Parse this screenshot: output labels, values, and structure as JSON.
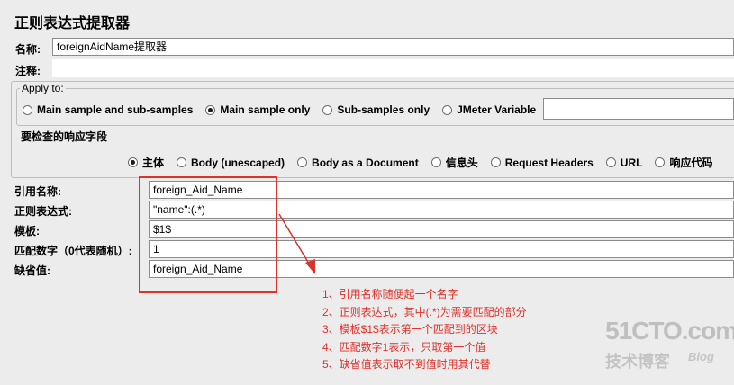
{
  "title": "正则表达式提取器",
  "name_label": "名称:",
  "name_value": "foreignAidName提取器",
  "comment_label": "注释:",
  "comment_value": "",
  "apply_to": {
    "legend": "Apply to:",
    "options": [
      {
        "label": "Main sample and sub-samples",
        "selected": false
      },
      {
        "label": "Main sample only",
        "selected": true
      },
      {
        "label": "Sub-samples only",
        "selected": false
      },
      {
        "label": "JMeter Variable",
        "selected": false
      }
    ],
    "variable_value": ""
  },
  "response_field": {
    "legend": "要检查的响应字段",
    "options": [
      {
        "label": "主体",
        "selected": true
      },
      {
        "label": "Body (unescaped)",
        "selected": false
      },
      {
        "label": "Body as a Document",
        "selected": false
      },
      {
        "label": "信息头",
        "selected": false
      },
      {
        "label": "Request Headers",
        "selected": false
      },
      {
        "label": "URL",
        "selected": false
      },
      {
        "label": "响应代码",
        "selected": false
      }
    ]
  },
  "fields": [
    {
      "label": "引用名称:",
      "value": "foreign_Aid_Name"
    },
    {
      "label": "正则表达式:",
      "value": "\"name\":(.*)"
    },
    {
      "label": "模板:",
      "value": "$1$"
    },
    {
      "label": "匹配数字（0代表随机）:",
      "value": "1"
    },
    {
      "label": "缺省值:",
      "value": "foreign_Aid_Name"
    }
  ],
  "annotations": [
    "1、引用名称随便起一个名字",
    "2、正则表达式，其中(.*)为需要匹配的部分",
    "3、模板$1$表示第一个匹配到的区块",
    "4、匹配数字1表示，只取第一个值",
    "5、缺省值表示取不到值时用其代替"
  ],
  "watermark": {
    "main": "51CTO.com",
    "sub": "技术博客",
    "blog": "Blog"
  },
  "colors": {
    "annotation": "#e0302a",
    "background": "#ececec"
  }
}
